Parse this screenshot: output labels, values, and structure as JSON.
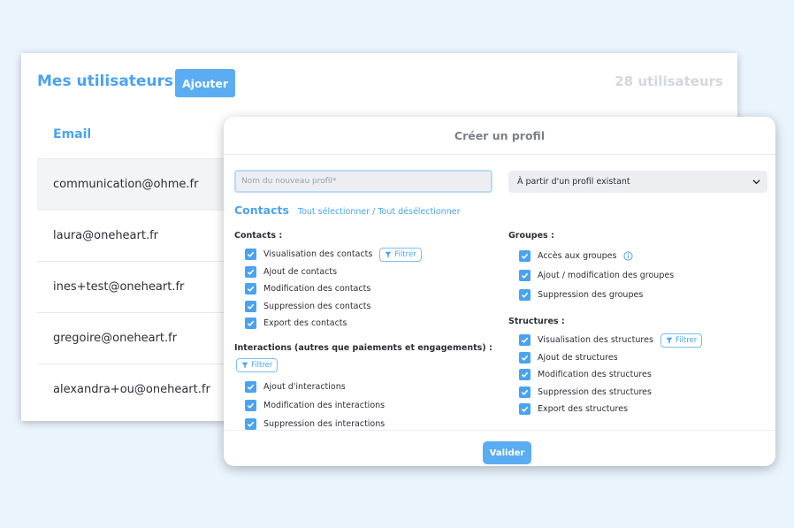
{
  "users": {
    "title": "Mes utilisateurs",
    "add_label": "Ajouter",
    "count": "28 utilisateurs",
    "email_header": "Email",
    "rows": [
      "communication@ohme.fr",
      "laura@oneheart.fr",
      "ines+test@oneheart.fr",
      "gregoire@oneheart.fr",
      "alexandra+ou@oneheart.fr"
    ]
  },
  "modal": {
    "title": "Créer un profil",
    "name_placeholder": "Nom du nouveau profil*",
    "select_value": "À partir d'un profil existant",
    "section_title": "Contacts",
    "select_all": "Tout sélectionner",
    "separator": "/",
    "deselect_all": "Tout désélectionner",
    "filter_label": "Filtrer",
    "validate_label": "Valider",
    "groups": {
      "contacts": {
        "title": "Contacts :",
        "items": [
          "Visualisation des contacts",
          "Ajout de contacts",
          "Modification des contacts",
          "Suppression des contacts",
          "Export des contacts"
        ]
      },
      "interactions": {
        "title": "Interactions (autres que paiements et engagements) :",
        "items": [
          "Ajout d'interactions",
          "Modification des interactions",
          "Suppression des interactions"
        ]
      },
      "groupes": {
        "title": "Groupes :",
        "items": [
          "Accès aux groupes",
          "Ajout / modification des groupes",
          "Suppression des groupes"
        ]
      },
      "structures": {
        "title": "Structures :",
        "items": [
          "Visualisation des structures",
          "Ajout de structures",
          "Modification des structures",
          "Suppression des structures",
          "Export des structures"
        ]
      }
    }
  },
  "colors": {
    "accent": "#4aa3f0",
    "button": "#5aadf2",
    "background": "#eaf4fd"
  }
}
